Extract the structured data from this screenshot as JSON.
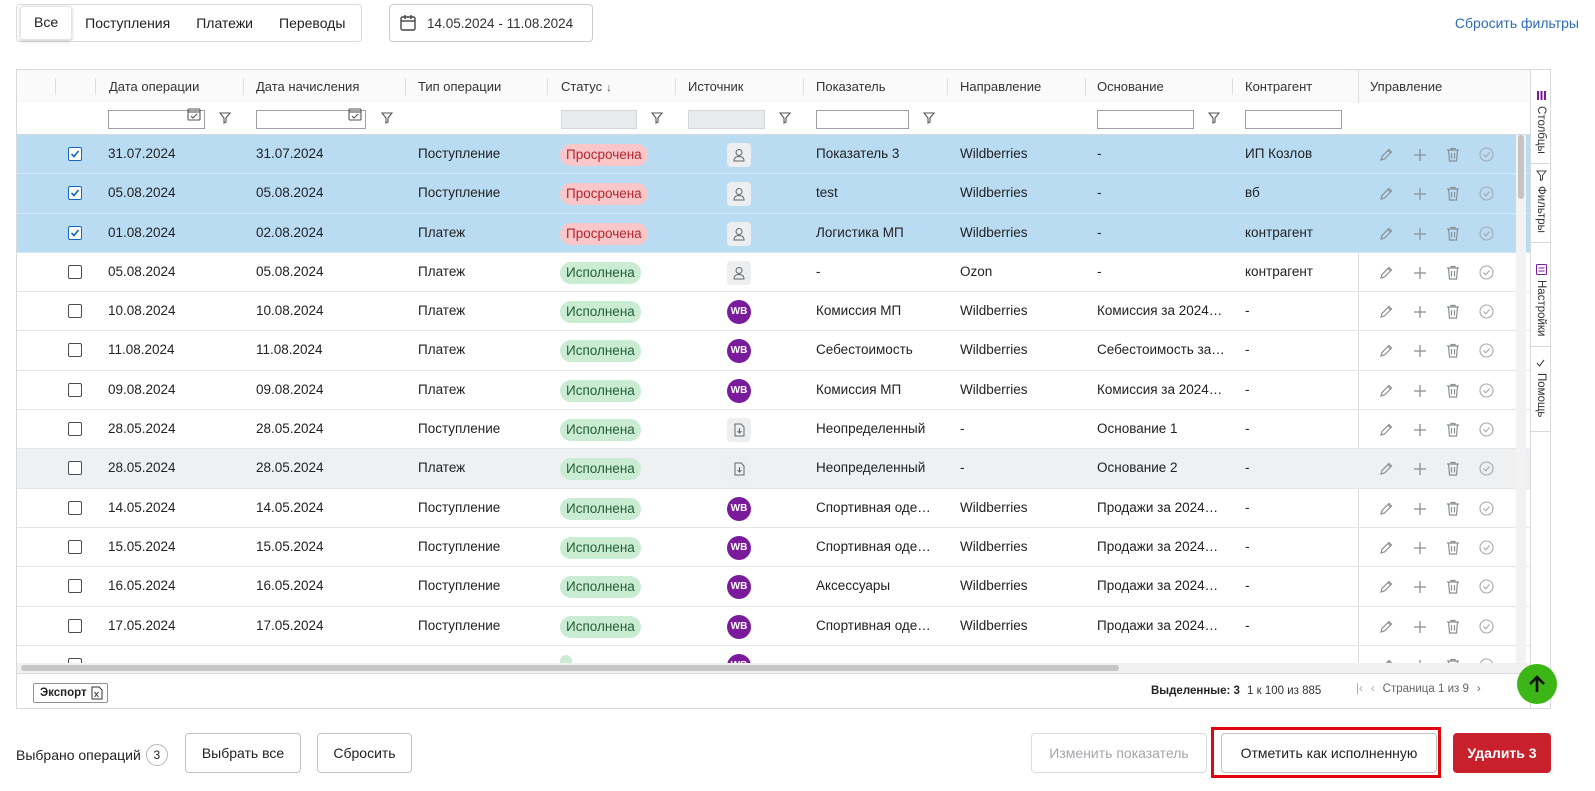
{
  "tabs": [
    {
      "label": "Все",
      "active": true
    },
    {
      "label": "Поступления",
      "active": false
    },
    {
      "label": "Платежи",
      "active": false
    },
    {
      "label": "Переводы",
      "active": false
    }
  ],
  "date_range": "14.05.2024 - 11.08.2024",
  "reset_filters": "Сбросить фильтры",
  "columns": {
    "op_date": "Дата операции",
    "accrual_date": "Дата начисления",
    "op_type": "Тип операции",
    "status": "Статус",
    "source": "Источник",
    "indicator": "Показатель",
    "direction": "Направление",
    "basis": "Основание",
    "counterparty": "Контрагент",
    "manage": "Управление"
  },
  "rows": [
    {
      "selected": true,
      "op_date": "31.07.2024",
      "accrual_date": "31.07.2024",
      "type": "Поступление",
      "status": "Просрочена",
      "status_kind": "overdue",
      "source": "person-icon",
      "indicator": "Показатель 3",
      "direction": "Wildberries",
      "basis": "-",
      "counterparty": "ИП Козлов"
    },
    {
      "selected": true,
      "op_date": "05.08.2024",
      "accrual_date": "05.08.2024",
      "type": "Поступление",
      "status": "Просрочена",
      "status_kind": "overdue",
      "source": "person-icon",
      "indicator": "test",
      "direction": "Wildberries",
      "basis": "-",
      "counterparty": "вб"
    },
    {
      "selected": true,
      "op_date": "01.08.2024",
      "accrual_date": "02.08.2024",
      "type": "Платеж",
      "status": "Просрочена",
      "status_kind": "overdue",
      "source": "person-icon",
      "indicator": "Логистика МП",
      "direction": "Wildberries",
      "basis": "-",
      "counterparty": "контрагент"
    },
    {
      "selected": false,
      "op_date": "05.08.2024",
      "accrual_date": "05.08.2024",
      "type": "Платеж",
      "status": "Исполнена",
      "status_kind": "done",
      "source": "person-icon",
      "indicator": "-",
      "direction": "Ozon",
      "basis": "-",
      "counterparty": "контрагент"
    },
    {
      "selected": false,
      "op_date": "10.08.2024",
      "accrual_date": "10.08.2024",
      "type": "Платеж",
      "status": "Исполнена",
      "status_kind": "done",
      "source": "wb-icon",
      "indicator": "Комиссия МП",
      "direction": "Wildberries",
      "basis": "Комиссия за 2024…",
      "counterparty": "-"
    },
    {
      "selected": false,
      "op_date": "11.08.2024",
      "accrual_date": "11.08.2024",
      "type": "Платеж",
      "status": "Исполнена",
      "status_kind": "done",
      "source": "wb-icon",
      "indicator": "Себестоимость",
      "direction": "Wildberries",
      "basis": "Себестоимость за…",
      "counterparty": "-"
    },
    {
      "selected": false,
      "op_date": "09.08.2024",
      "accrual_date": "09.08.2024",
      "type": "Платеж",
      "status": "Исполнена",
      "status_kind": "done",
      "source": "wb-icon",
      "indicator": "Комиссия МП",
      "direction": "Wildberries",
      "basis": "Комиссия за 2024…",
      "counterparty": "-"
    },
    {
      "selected": false,
      "op_date": "28.05.2024",
      "accrual_date": "28.05.2024",
      "type": "Поступление",
      "status": "Исполнена",
      "status_kind": "done",
      "source": "file-import-icon",
      "indicator": "Неопределенный",
      "direction": "-",
      "basis": "Основание 1",
      "counterparty": "-"
    },
    {
      "selected": false,
      "hover": true,
      "op_date": "28.05.2024",
      "accrual_date": "28.05.2024",
      "type": "Платеж",
      "status": "Исполнена",
      "status_kind": "done",
      "source": "file-import-icon",
      "indicator": "Неопределенный",
      "direction": "-",
      "basis": "Основание 2",
      "counterparty": "-"
    },
    {
      "selected": false,
      "op_date": "14.05.2024",
      "accrual_date": "14.05.2024",
      "type": "Поступление",
      "status": "Исполнена",
      "status_kind": "done",
      "source": "wb-icon",
      "indicator": "Спортивная оде…",
      "direction": "Wildberries",
      "basis": "Продажи за 2024…",
      "counterparty": "-"
    },
    {
      "selected": false,
      "op_date": "15.05.2024",
      "accrual_date": "15.05.2024",
      "type": "Поступление",
      "status": "Исполнена",
      "status_kind": "done",
      "source": "wb-icon",
      "indicator": "Спортивная оде…",
      "direction": "Wildberries",
      "basis": "Продажи за 2024…",
      "counterparty": "-"
    },
    {
      "selected": false,
      "op_date": "16.05.2024",
      "accrual_date": "16.05.2024",
      "type": "Поступление",
      "status": "Исполнена",
      "status_kind": "done",
      "source": "wb-icon",
      "indicator": "Аксессуары",
      "direction": "Wildberries",
      "basis": "Продажи за 2024…",
      "counterparty": "-"
    },
    {
      "selected": false,
      "op_date": "17.05.2024",
      "accrual_date": "17.05.2024",
      "type": "Поступление",
      "status": "Исполнена",
      "status_kind": "done",
      "source": "wb-icon",
      "indicator": "Спортивная оде…",
      "direction": "Wildberries",
      "basis": "Продажи за 2024…",
      "counterparty": "-"
    },
    {
      "selected": false,
      "op_date": "",
      "accrual_date": "",
      "type": "",
      "status": "",
      "status_kind": "done",
      "source": "wb-icon",
      "indicator": "",
      "direction": "",
      "basis": "",
      "counterparty": ""
    }
  ],
  "wb_badge": "WB",
  "side_panel": {
    "columns": "Столбцы",
    "filters": "Фильтры",
    "settings": "Настройки",
    "help": "Помощь"
  },
  "footer": {
    "export": "Экспорт",
    "selected_label": "Выделенные:",
    "selected_count": "3",
    "range": "1 к 100 из 885",
    "page": "Страница 1 из 9"
  },
  "bottom": {
    "selected_ops_label": "Выбрано операций",
    "selected_ops_count": "3",
    "select_all": "Выбрать все",
    "reset": "Сбросить",
    "change_indicator": "Изменить показатель",
    "mark_done": "Отметить как исполненную",
    "delete": "Удалить 3"
  },
  "colors": {
    "accent": "#2f6ab7",
    "selected_row": "#b9dcf3",
    "danger": "#c8212c",
    "scroll_top": "#3cb516"
  }
}
